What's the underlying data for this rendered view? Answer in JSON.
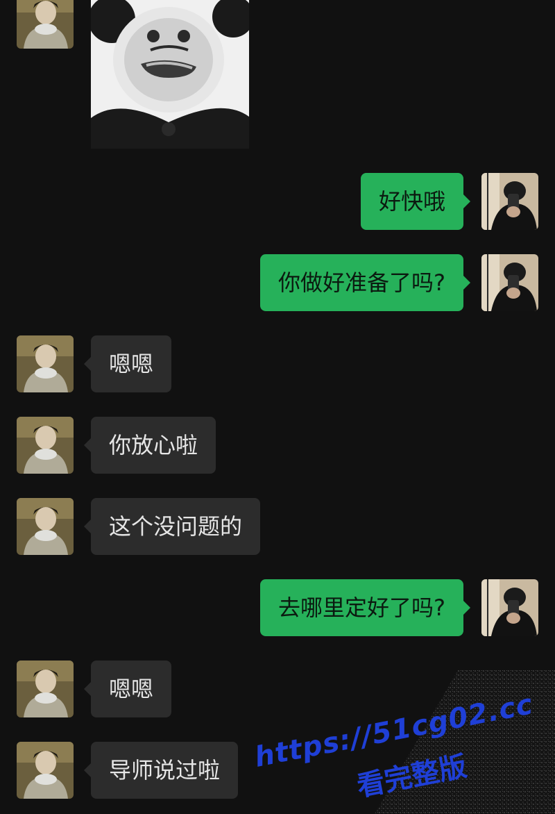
{
  "messages": [
    {
      "side": "in",
      "type": "sticker",
      "sticker": "panda-meme"
    },
    {
      "side": "out",
      "text": "好快哦"
    },
    {
      "side": "out",
      "text": "你做好准备了吗?"
    },
    {
      "side": "in",
      "text": "嗯嗯"
    },
    {
      "side": "in",
      "text": "你放心啦"
    },
    {
      "side": "in",
      "text": "这个没问题的"
    },
    {
      "side": "out",
      "text": "去哪里定好了吗?"
    },
    {
      "side": "in",
      "text": "嗯嗯"
    },
    {
      "side": "in",
      "text": "导师说过啦"
    }
  ],
  "watermark": {
    "url": "https://51cg02.cc",
    "sub": "看完整版"
  },
  "colors": {
    "background": "#111111",
    "incoming_bubble": "#2c2c2c",
    "outgoing_bubble": "#26b15a",
    "watermark": "#1f3fd6"
  }
}
